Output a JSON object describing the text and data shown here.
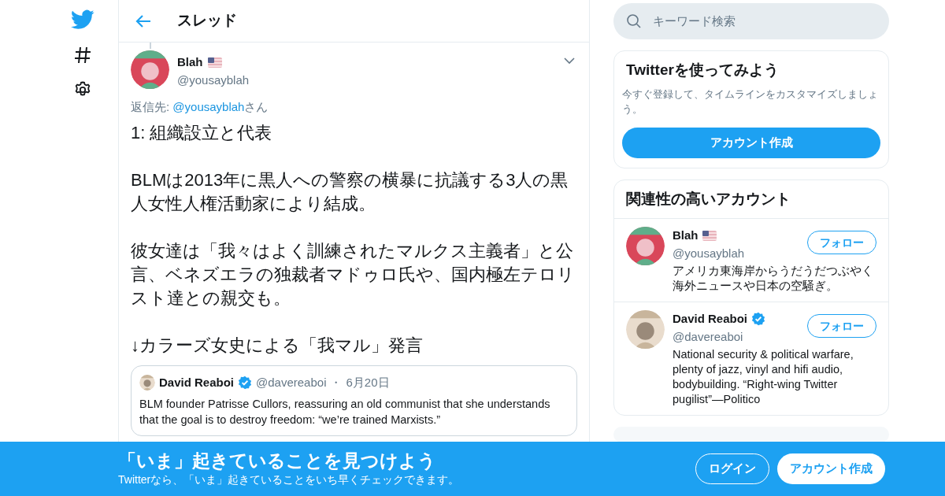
{
  "header": {
    "title": "スレッド"
  },
  "tweet": {
    "name": "Blah",
    "handle": "@yousayblah",
    "reply_prefix": "返信先: ",
    "reply_to": "@yousayblah",
    "reply_suffix": "さん",
    "paragraphs": [
      "1: 組織設立と代表",
      "BLMは2013年に黒人への警察の横暴に抗議する3人の黒人女性人権活動家により結成。",
      "彼女達は「我々はよく訓練されたマルクス主義者」と公言、ベネズエラの独裁者マドゥロ氏や、国内極左テロリスト達との親交も。",
      "↓カラーズ女史による「我マル」発言"
    ],
    "quote": {
      "name": "David Reaboi",
      "verified": true,
      "handle": "@davereaboi",
      "sep": "・",
      "date": "6月20日",
      "text": "BLM founder Patrisse Cullors, reassuring an old communist that she understands that the goal is to destroy freedom: “we’re trained Marxists.”"
    }
  },
  "search": {
    "placeholder": "キーワード検索"
  },
  "signup_card": {
    "title": "Twitterを使ってみよう",
    "text": "今すぐ登録して、タイムラインをカスタマイズしましょう。",
    "button": "アカウント作成"
  },
  "related": {
    "title": "関連性の高いアカウント",
    "accounts": [
      {
        "name": "Blah",
        "flag": true,
        "verified": false,
        "handle": "@yousayblah",
        "follow": "フォロー",
        "bio": "アメリカ東海岸からうだうだつぶやく海外ニュースや日本の空騒ぎ。"
      },
      {
        "name": "David Reaboi",
        "flag": false,
        "verified": true,
        "handle": "@davereaboi",
        "follow": "フォロー",
        "bio": "National security & political warfare, plenty of jazz, vinyl and hifi audio, bodybuilding. “Right-wing Twitter pugilist”—Politico"
      }
    ]
  },
  "banner": {
    "title": "「いま」起きていることを見つけよう",
    "text": "Twitterなら、「いま」起きていることをいち早くチェックできます。",
    "login": "ログイン",
    "signup": "アカウント作成"
  }
}
